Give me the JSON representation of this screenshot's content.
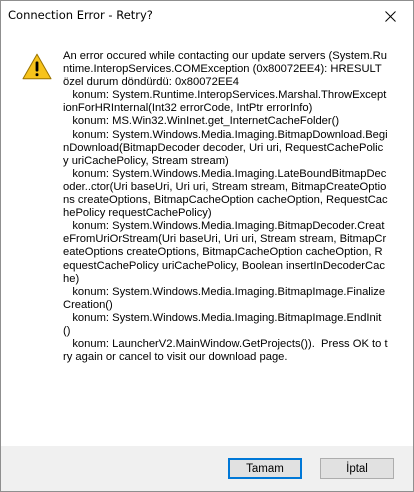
{
  "window": {
    "title": "Connection Error - Retry?"
  },
  "dialog": {
    "icon": "warning-icon",
    "message": "An error occured while contacting our update servers (System.Runtime.InteropServices.COMException (0x80072EE4): HRESULT özel durum döndürdü: 0x80072EE4\n   konum: System.Runtime.InteropServices.Marshal.ThrowExceptionForHRInternal(Int32 errorCode, IntPtr errorInfo)\n   konum: MS.Win32.WinInet.get_InternetCacheFolder()\n   konum: System.Windows.Media.Imaging.BitmapDownload.BeginDownload(BitmapDecoder decoder, Uri uri, RequestCachePolicy uriCachePolicy, Stream stream)\n   konum: System.Windows.Media.Imaging.LateBoundBitmapDecoder..ctor(Uri baseUri, Uri uri, Stream stream, BitmapCreateOptions createOptions, BitmapCacheOption cacheOption, RequestCachePolicy requestCachePolicy)\n   konum: System.Windows.Media.Imaging.BitmapDecoder.CreateFromUriOrStream(Uri baseUri, Uri uri, Stream stream, BitmapCreateOptions createOptions, BitmapCacheOption cacheOption, RequestCachePolicy uriCachePolicy, Boolean insertInDecoderCache)\n   konum: System.Windows.Media.Imaging.BitmapImage.FinalizeCreation()\n   konum: System.Windows.Media.Imaging.BitmapImage.EndInit()\n   konum: LauncherV2.MainWindow.GetProjects()).  Press OK to try again or cancel to visit our download page."
  },
  "buttons": {
    "ok_label": "Tamam",
    "cancel_label": "İptal"
  },
  "colors": {
    "accent": "#0078d7",
    "warning_fill": "#f7c31b"
  }
}
